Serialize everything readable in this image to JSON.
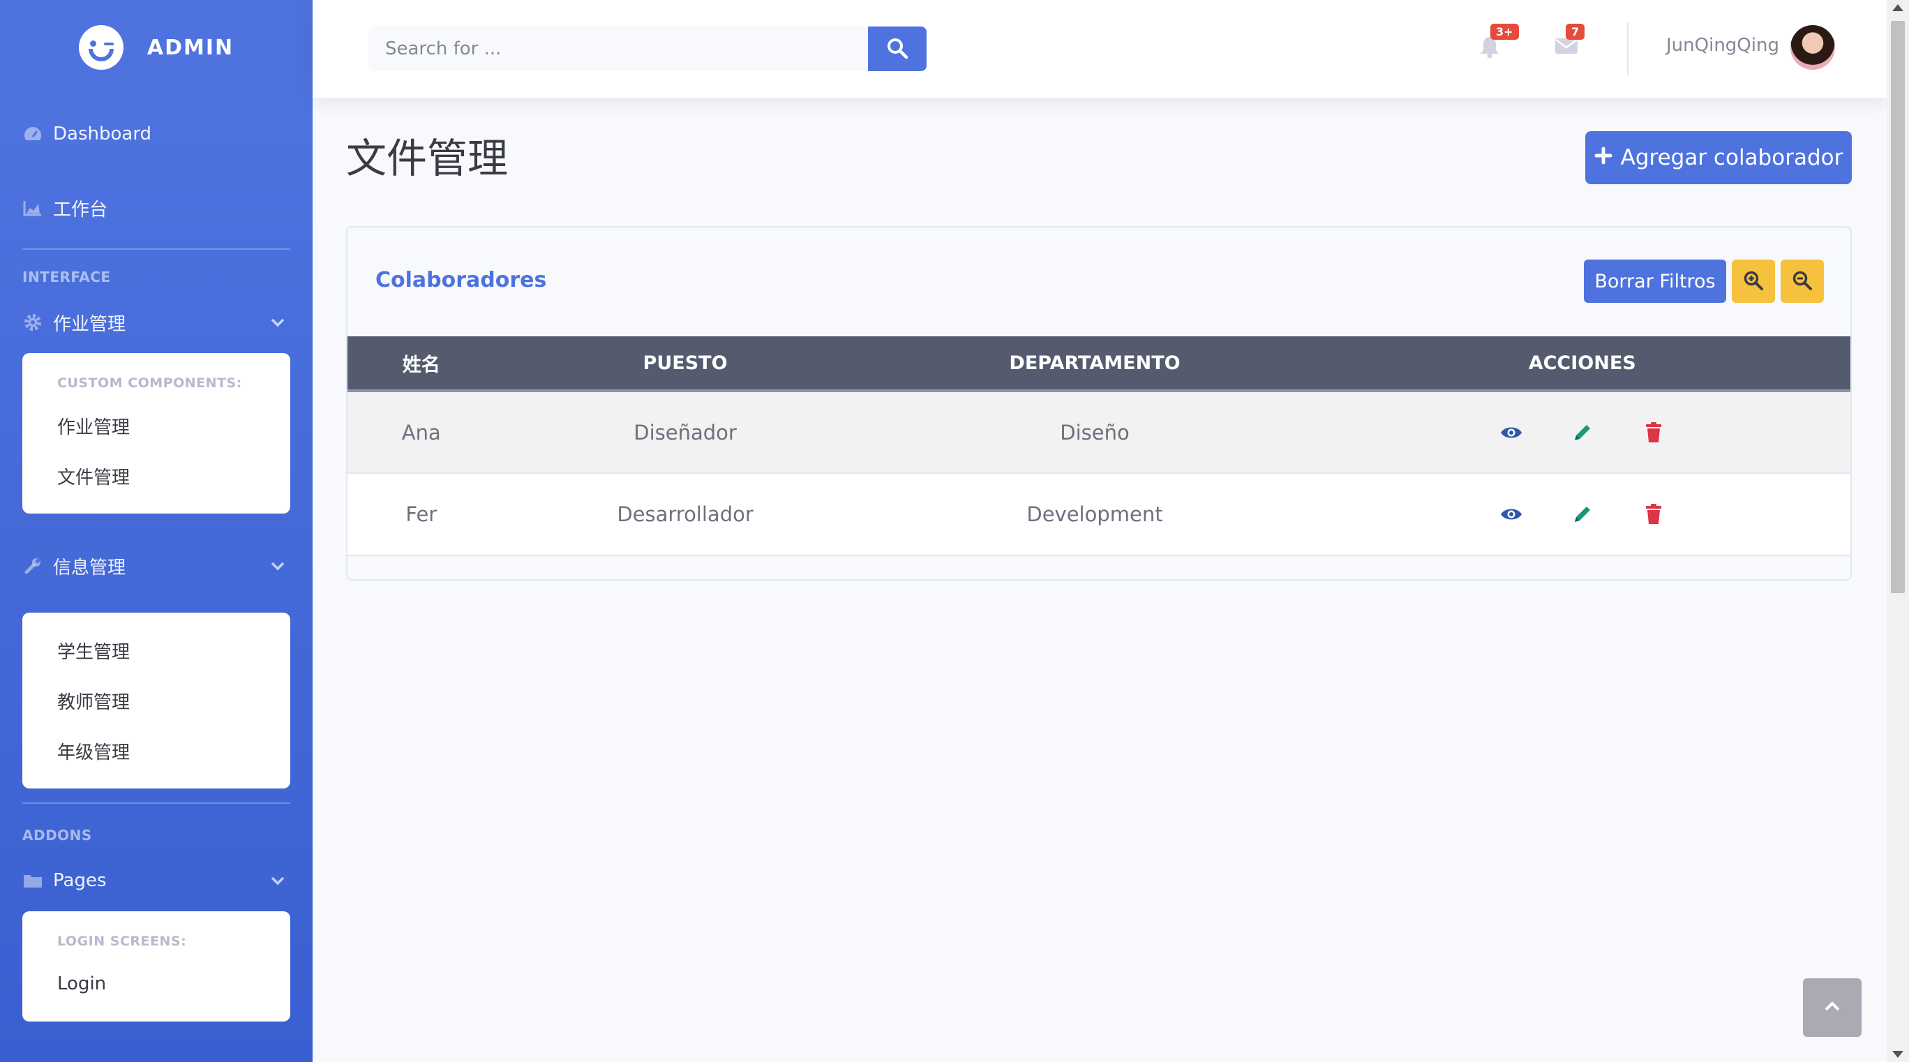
{
  "brand": {
    "name": "ADMIN"
  },
  "sidebar": {
    "dashboard": "Dashboard",
    "workbench": "工作台",
    "interface_heading": "INTERFACE",
    "homework": {
      "label": "作业管理",
      "sub_heading": "CUSTOM COMPONENTS:",
      "items": [
        "作业管理",
        "文件管理"
      ]
    },
    "info": {
      "label": "信息管理",
      "items": [
        "学生管理",
        "教师管理",
        "年级管理"
      ]
    },
    "addons_heading": "ADDONS",
    "pages": {
      "label": "Pages",
      "sub_heading": "LOGIN SCREENS:",
      "items": [
        "Login"
      ]
    }
  },
  "topbar": {
    "search_placeholder": "Search for ...",
    "alerts_badge": "3+",
    "messages_badge": "7",
    "user_name": "JunQingQing"
  },
  "main": {
    "page_title": "文件管理",
    "add_button": "Agregar colaborador",
    "card_title": "Colaboradores",
    "clear_filters": "Borrar Filtros",
    "table": {
      "headers": [
        "姓名",
        "PUESTO",
        "DEPARTAMENTO",
        "ACCIONES"
      ],
      "rows": [
        {
          "name": "Ana",
          "puesto": "Diseñador",
          "departamento": "Diseño"
        },
        {
          "name": "Fer",
          "puesto": "Desarrollador",
          "departamento": "Development"
        }
      ]
    }
  },
  "colors": {
    "primary": "#4e73df",
    "warning": "#f6c23e",
    "danger": "#e74a3b",
    "success": "#1cc88a",
    "table_header": "#545b6e"
  },
  "icons": {
    "dashboard": "tachometer-icon",
    "workbench": "chart-area-icon",
    "homework": "gear-icon",
    "info": "wrench-icon",
    "pages": "folder-icon",
    "search": "search-icon",
    "alerts": "bell-icon",
    "messages": "envelope-icon",
    "add": "plus-icon",
    "zoom_in": "search-plus-icon",
    "zoom_out": "search-minus-icon",
    "view": "eye-icon",
    "edit": "pencil-icon",
    "delete": "trash-icon",
    "back_to_top": "chevron-up-icon"
  }
}
